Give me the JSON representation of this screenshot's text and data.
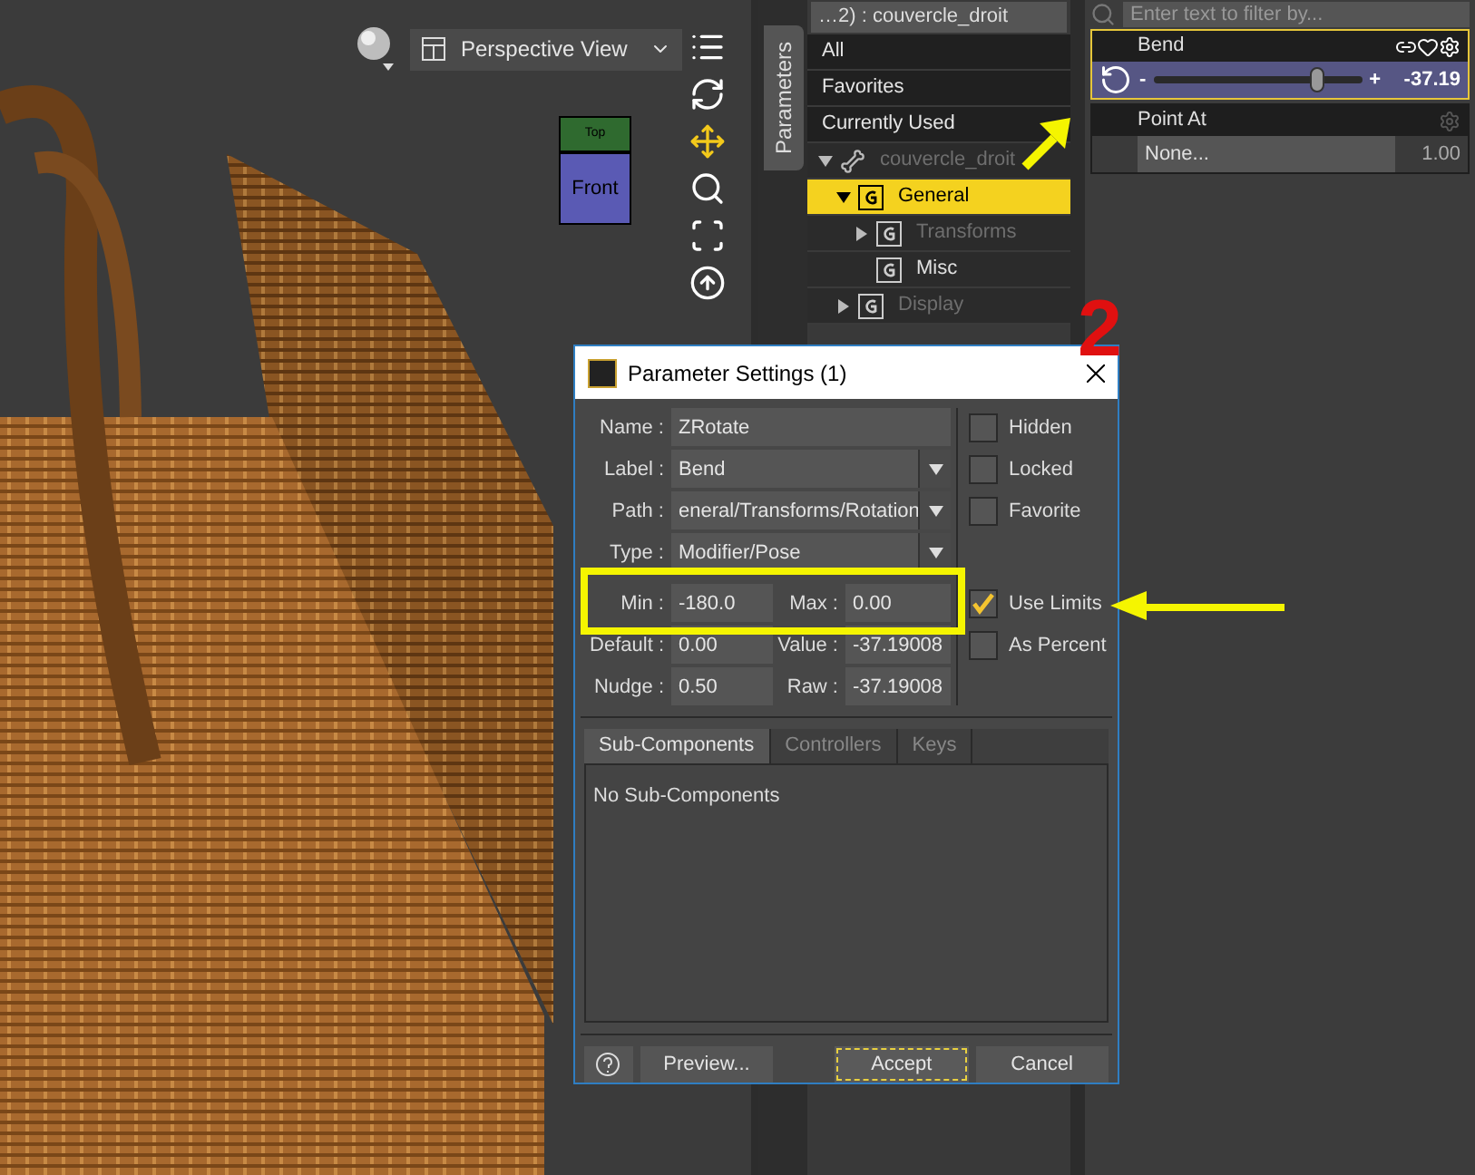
{
  "viewport": {
    "view_dropdown": "Perspective View",
    "view_cube": {
      "top": "Top",
      "front": "Front"
    }
  },
  "side_tab": {
    "label": "Parameters",
    "selected": true
  },
  "tree_panel": {
    "node_dropdown": "…2) : couvercle_droit",
    "categories": [
      {
        "label": "All",
        "selected": false
      },
      {
        "label": "Favorites",
        "selected": false
      },
      {
        "label": "Currently Used",
        "selected": false
      }
    ],
    "tree": [
      {
        "label": "couvercle_droit",
        "kind": "node",
        "expanded": true,
        "disabled": true,
        "selected": false,
        "children": [
          {
            "label": "General",
            "kind": "group",
            "expanded": true,
            "disabled": false,
            "selected": true,
            "children": [
              {
                "label": "Transforms",
                "kind": "group",
                "expanded": false,
                "disabled": true,
                "selected": false
              },
              {
                "label": "Misc",
                "kind": "group",
                "disabled": false,
                "selected": false
              }
            ]
          },
          {
            "label": "Display",
            "kind": "group",
            "expanded": false,
            "disabled": true,
            "selected": false
          }
        ]
      }
    ]
  },
  "parameters_panel": {
    "filter_placeholder": "Enter text to filter by...",
    "params": [
      {
        "kind": "slider",
        "label": "Bend",
        "selected": true,
        "minus": "-",
        "plus": "+",
        "level": 0.79,
        "value": "-37.19"
      },
      {
        "kind": "node",
        "label": "Point At",
        "selected": false,
        "button": "None...",
        "value": "1.00"
      }
    ]
  },
  "dialog": {
    "title": "Parameter Settings (1)",
    "fields": [
      {
        "kind": "text",
        "label": "Name :",
        "value": "ZRotate"
      },
      {
        "kind": "combo",
        "label": "Label :",
        "value": "Bend"
      },
      {
        "kind": "combo",
        "label": "Path :",
        "value": "eneral/Transforms/Rotation"
      },
      {
        "kind": "combo",
        "label": "Type :",
        "value": "Modifier/Pose"
      }
    ],
    "pairs": [
      {
        "left_label": "Min :",
        "left_value": "-180.0",
        "right_label": "Max :",
        "right_value": "0.00"
      },
      {
        "left_label": "Default :",
        "left_value": "0.00",
        "right_label": "Value :",
        "right_value": "-37.19008"
      },
      {
        "left_label": "Nudge :",
        "left_value": "0.50",
        "right_label": "Raw :",
        "right_value": "-37.19008"
      }
    ],
    "checkboxes": [
      {
        "label": "Hidden",
        "checked": false
      },
      {
        "label": "Locked",
        "checked": false
      },
      {
        "label": "Favorite",
        "checked": false
      },
      {
        "label": "Use Limits",
        "checked": true
      },
      {
        "label": "As Percent",
        "checked": false
      }
    ],
    "tabs": [
      {
        "label": "Sub-Components",
        "selected": true
      },
      {
        "label": "Controllers",
        "selected": false
      },
      {
        "label": "Keys",
        "selected": false
      }
    ],
    "tab_content": "No Sub-Components",
    "buttons": [
      {
        "label": "Preview...",
        "focused": false
      },
      {
        "label": "Accept",
        "focused": true
      },
      {
        "label": "Cancel",
        "focused": false
      }
    ]
  },
  "annotations": {
    "step_number": "2"
  }
}
